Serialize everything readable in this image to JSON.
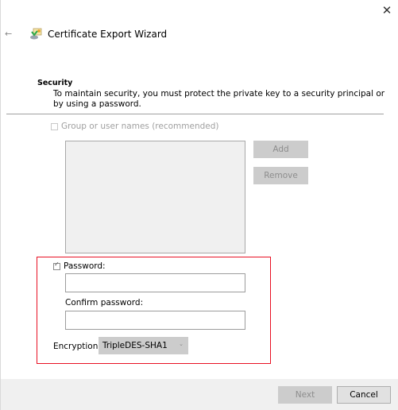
{
  "window": {
    "title": "Certificate Export Wizard",
    "close_glyph": "✕",
    "back_glyph": "←"
  },
  "security": {
    "heading": "Security",
    "description": "To maintain security, you must protect the private key to a security principal or by using a password."
  },
  "group": {
    "checkbox_label": "Group or user names (recommended)",
    "checked": false,
    "enabled": false,
    "add_label": "Add",
    "remove_label": "Remove"
  },
  "password": {
    "checkbox_label": "Password:",
    "checked": true,
    "value": "",
    "confirm_label": "Confirm password:",
    "confirm_value": ""
  },
  "encryption": {
    "label": "Encryption:",
    "selected": "TripleDES-SHA1",
    "chevron": "⌄"
  },
  "footer": {
    "next_label": "Next",
    "cancel_label": "Cancel"
  },
  "colors": {
    "highlight_border": "#e81123",
    "disabled_button": "#cccccc",
    "footer_bg": "#f0f0f0"
  }
}
